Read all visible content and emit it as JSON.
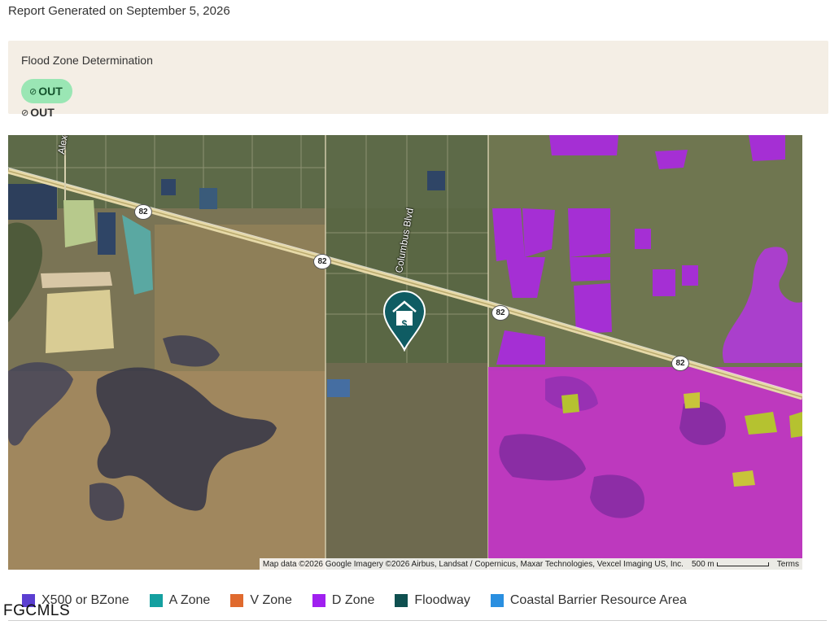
{
  "report": {
    "date_text": "Report Generated on September 5, 2026"
  },
  "flood": {
    "title": "Flood Zone Determination",
    "status_pill": "OUT",
    "status_plain": "OUT",
    "check_glyph": "⊘",
    "pill_color": "#9ae6b4"
  },
  "map": {
    "road_labels": {
      "alexander": "Alexander",
      "columbus": "Columbus Blvd"
    },
    "highway_shield": "82",
    "marker_icon": "house-dollar-marker-icon",
    "marker_glyph": "$",
    "attribution": "Map data ©2026 Google Imagery ©2026 Airbus, Landsat / Copernicus, Maxar Technologies, Vexcel Imaging US, Inc.",
    "scale": "500 m",
    "terms": "Terms"
  },
  "legend": [
    {
      "label": "X500 or BZone",
      "color": "#5b3fd1"
    },
    {
      "label": "A Zone",
      "color": "#14a0a0"
    },
    {
      "label": "V Zone",
      "color": "#e06a2e"
    },
    {
      "label": "D Zone",
      "color": "#a020f0"
    },
    {
      "label": "Floodway",
      "color": "#0f5050"
    },
    {
      "label": "Coastal Barrier Resource Area",
      "color": "#2a8fe0"
    }
  ],
  "watermark": "FGCMLS"
}
